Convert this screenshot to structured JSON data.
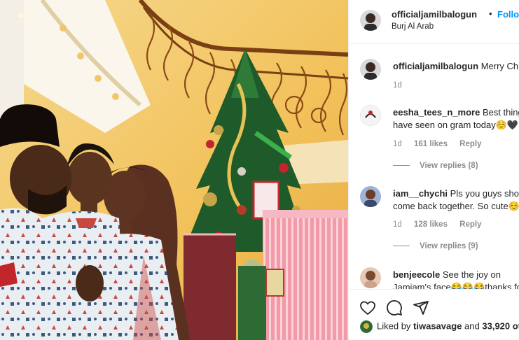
{
  "post": {
    "author": "officialjamilbalogun",
    "follow_label": "Follow",
    "location": "Burj Al Arab",
    "separator": "•"
  },
  "caption": {
    "username": "officialjamilbalogun",
    "text": "Merry Chr",
    "time": "1d"
  },
  "comments": [
    {
      "username": "eesha_tees_n_more",
      "text": "Best thing I have seen on gram today☺️🖤☺️",
      "time": "1d",
      "likes": "161 likes",
      "reply_label": "Reply",
      "view_replies": "View replies (8)"
    },
    {
      "username": "iam__chychi",
      "text": "Pls you guys should come back together. So cute☺️",
      "time": "1d",
      "likes": "128 likes",
      "reply_label": "Reply",
      "view_replies": "View replies (9)"
    },
    {
      "username": "benjeecole",
      "text": "See the joy on Jamiam's face😂😂😂thanks for",
      "time": "",
      "likes": "",
      "reply_label": "",
      "view_replies": ""
    }
  ],
  "actions": {
    "like_icon": "heart-icon",
    "comment_icon": "comment-icon",
    "share_icon": "send-icon"
  },
  "liked_by": {
    "prefix": "Liked by",
    "user": "tiwasavage",
    "and": "and",
    "count": "33,920",
    "suffix": "ot"
  },
  "colors": {
    "link_blue": "#0095f6",
    "secondary_text": "#8e8e8e",
    "border": "#efefef"
  }
}
